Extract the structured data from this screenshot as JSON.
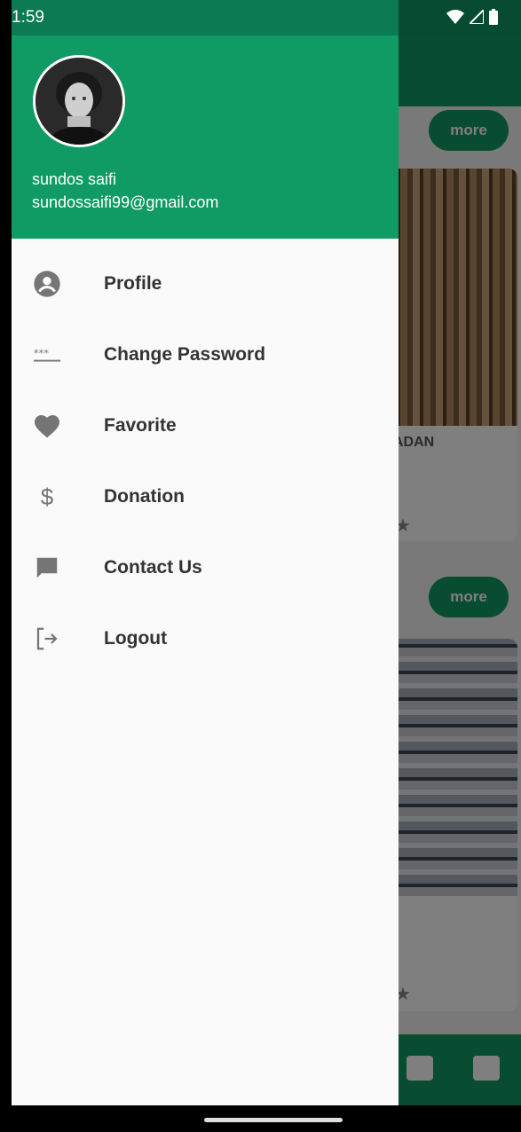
{
  "status_bar": {
    "time": "1:59"
  },
  "drawer": {
    "user": {
      "name": "sundos saifi",
      "email": "sundossaifi99@gmail.com"
    },
    "menu": [
      {
        "label": "Profile",
        "icon": "account-circle-icon"
      },
      {
        "label": "Change Password",
        "icon": "password-icon"
      },
      {
        "label": "Favorite",
        "icon": "heart-icon"
      },
      {
        "label": "Donation",
        "icon": "dollar-icon"
      },
      {
        "label": "Contact Us",
        "icon": "chat-icon"
      },
      {
        "label": "Logout",
        "icon": "logout-icon"
      }
    ]
  },
  "background": {
    "more_label": "more",
    "card1_title": "ADAN"
  },
  "colors": {
    "primary": "#109a64",
    "primary_dark": "#0c7a52",
    "icon_gray": "#757575"
  }
}
